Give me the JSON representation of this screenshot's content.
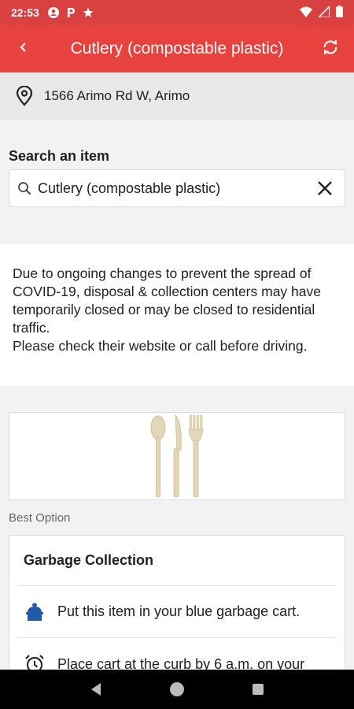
{
  "status_bar": {
    "time": "22:53",
    "icons": [
      "account-circle-icon",
      "p-icon",
      "star-icon"
    ],
    "right_icons": [
      "wifi-icon",
      "signal-icon",
      "battery-icon"
    ]
  },
  "app_bar": {
    "title": "Cutlery (compostable plastic)",
    "back_icon": "chevron-left-icon",
    "refresh_icon": "refresh-icon",
    "color": "#e8423f"
  },
  "address": {
    "text": "1566 Arimo Rd W, Arimo",
    "icon": "location-pin-icon"
  },
  "search": {
    "label": "Search an item",
    "value": "Cutlery (compostable plastic)"
  },
  "notice": {
    "text": "Due to ongoing changes to prevent the spread of COVID-19, disposal & collection centers may have temporarily closed or may be closed to residential traffic.\nPlease check their website or call before driving."
  },
  "result": {
    "best_option_label": "Best Option",
    "card_title": "Garbage Collection",
    "rows": [
      {
        "icon": "garbage-cart-icon",
        "text": "Put this item in your blue garbage cart."
      },
      {
        "icon": "alarm-clock-icon",
        "text": "Place cart at the curb by 6 a.m. on your"
      }
    ]
  },
  "nav": [
    "back-triangle-icon",
    "home-circle-icon",
    "recents-square-icon"
  ]
}
